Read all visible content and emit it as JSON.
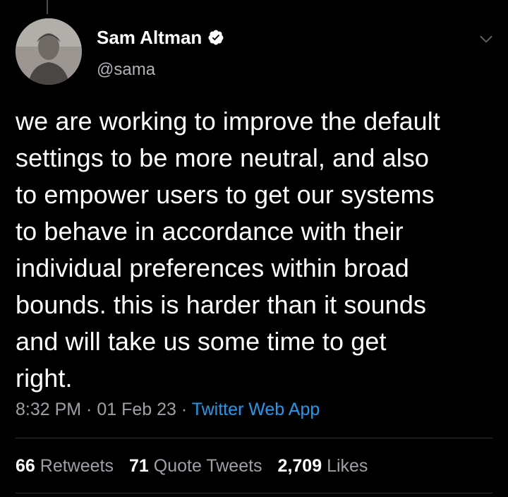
{
  "user": {
    "display_name": "Sam Altman",
    "handle": "@sama",
    "verified": true
  },
  "tweet": {
    "text": "we are working to improve the default\nsettings to be more neutral, and also\nto empower users to get our systems\nto behave in accordance with their\nindividual preferences within broad\nbounds. this is harder than it sounds\nand will take us some time to get\nright."
  },
  "meta": {
    "time": "8:32 PM",
    "sep1": " · ",
    "date": "01 Feb 23",
    "sep2": " · ",
    "source": "Twitter Web App"
  },
  "stats": {
    "retweets_count": "66",
    "retweets_label": "Retweets",
    "quotes_count": "71",
    "quotes_label": "Quote Tweets",
    "likes_count": "2,709",
    "likes_label": "Likes"
  },
  "icons": {
    "verified": "verified-badge-icon",
    "more": "chevron-down-icon"
  },
  "colors": {
    "background": "#000000",
    "text": "#ffffff",
    "muted": "#9da1a5",
    "link": "#1d9bf0"
  }
}
